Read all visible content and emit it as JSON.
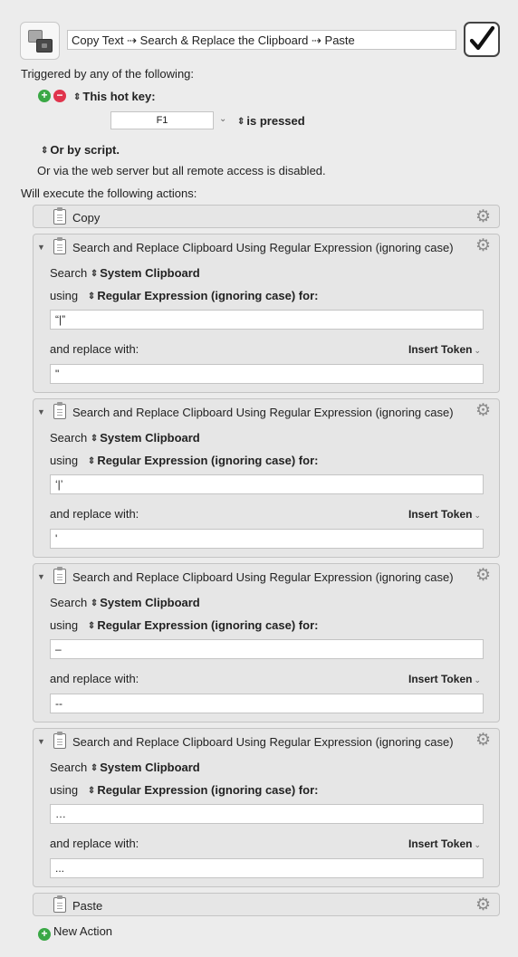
{
  "header": {
    "title": "Copy Text ⇢ Search & Replace the Clipboard ⇢ Paste",
    "enabled_checkmark": "✓",
    "macro_icon": "copy-paste-icon"
  },
  "triggers": {
    "heading": "Triggered by any of the following:",
    "hotkey_label": "This hot key:",
    "hotkey_value": "F1",
    "hotkey_state": "is pressed",
    "script_label": "Or by script.",
    "web_server_text": "Or via the web server but all remote access is disabled."
  },
  "actions_heading": "Will execute the following actions:",
  "actions": [
    {
      "type": "simple",
      "title": "Copy"
    },
    {
      "type": "search_replace",
      "title": "Search and Replace Clipboard Using Regular Expression (ignoring case)",
      "search_label": "Search",
      "search_target": "System Clipboard",
      "using_label": "using",
      "using_mode": "Regular Expression (ignoring case) for:",
      "pattern": "“|”",
      "replace_label": "and replace with:",
      "insert_token": "Insert Token",
      "replacement": "\""
    },
    {
      "type": "search_replace",
      "title": "Search and Replace Clipboard Using Regular Expression (ignoring case)",
      "search_label": "Search",
      "search_target": "System Clipboard",
      "using_label": "using",
      "using_mode": "Regular Expression (ignoring case) for:",
      "pattern": "‘|’",
      "replace_label": "and replace with:",
      "insert_token": "Insert Token",
      "replacement": "'"
    },
    {
      "type": "search_replace",
      "title": "Search and Replace Clipboard Using Regular Expression (ignoring case)",
      "search_label": "Search",
      "search_target": "System Clipboard",
      "using_label": "using",
      "using_mode": "Regular Expression (ignoring case) for:",
      "pattern": "–",
      "replace_label": "and replace with:",
      "insert_token": "Insert Token",
      "replacement": "--"
    },
    {
      "type": "search_replace",
      "title": "Search and Replace Clipboard Using Regular Expression (ignoring case)",
      "search_label": "Search",
      "search_target": "System Clipboard",
      "using_label": "using",
      "using_mode": "Regular Expression (ignoring case) for:",
      "pattern": "…",
      "replace_label": "and replace with:",
      "insert_token": "Insert Token",
      "replacement": "..."
    },
    {
      "type": "simple",
      "title": "Paste"
    }
  ],
  "new_action_label": "New Action",
  "icons": {
    "add": "plus-circle-icon",
    "remove": "minus-circle-icon",
    "gear": "gear-icon",
    "disclosure": "disclosure-triangle-icon"
  },
  "colors": {
    "add_green": "#3aa845",
    "remove_red": "#e0344c"
  }
}
